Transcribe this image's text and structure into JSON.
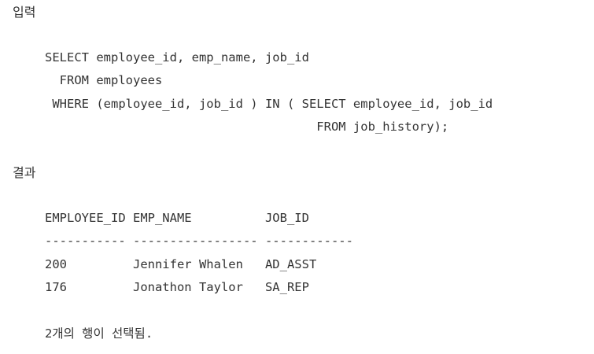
{
  "input": {
    "heading": "입력",
    "lines": [
      "SELECT employee_id, emp_name, job_id",
      "  FROM employees",
      " WHERE (employee_id, job_id ) IN ( SELECT employee_id, job_id",
      "                                     FROM job_history);"
    ]
  },
  "result": {
    "heading": "결과",
    "lines": [
      "EMPLOYEE_ID EMP_NAME          JOB_ID",
      "----------- ----------------- ------------",
      "200         Jennifer Whalen   AD_ASST",
      "176         Jonathon Taylor   SA_REP",
      "",
      "2개의 행이 선택됨."
    ]
  }
}
